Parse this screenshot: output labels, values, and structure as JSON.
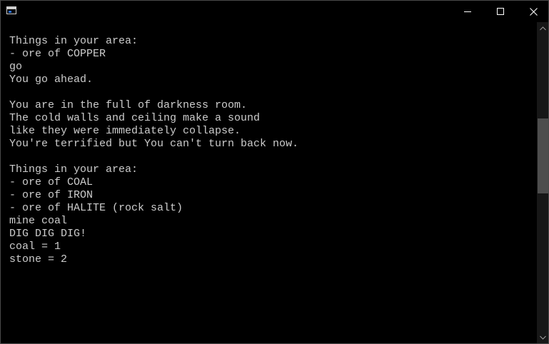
{
  "window": {
    "title": "",
    "icon": "console-app-icon"
  },
  "console": {
    "lines": [
      "",
      "Things in your area:",
      "- ore of COPPER",
      "go",
      "You go ahead.",
      "",
      "You are in the full of darkness room.",
      "The cold walls and ceiling make a sound",
      "like they were immediately collapse.",
      "You're terrified but You can't turn back now.",
      "",
      "Things in your area:",
      "- ore of COAL",
      "- ore of IRON",
      "- ore of HALITE (rock salt)",
      "mine coal",
      "DIG DIG DIG!",
      "coal = 1",
      "stone = 2"
    ]
  },
  "scroll": {
    "position_fraction": 0.38
  },
  "colors": {
    "background": "#000000",
    "text": "#cccccc",
    "scrollbar_track": "#171717",
    "scrollbar_thumb": "#4d4d4d"
  }
}
